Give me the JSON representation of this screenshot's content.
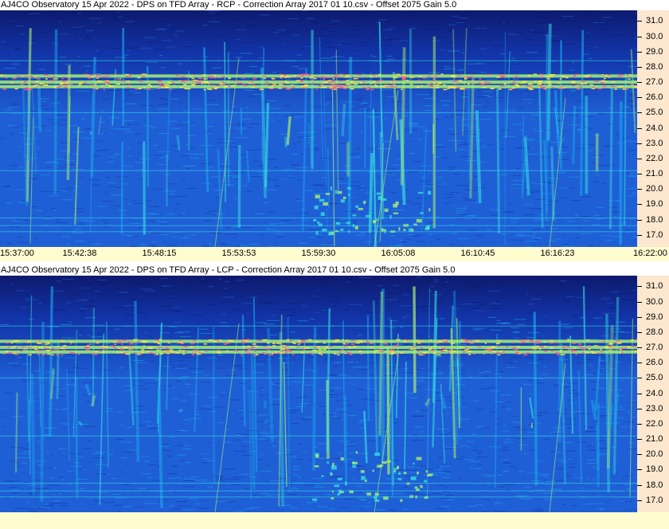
{
  "panels": [
    {
      "title": "AJ4CO Observatory 15 Apr 2022  -  DPS on TFD Array  -  RCP  -  Correction Array 2017 01 10.csv  -  Offset 2075  Gain 5.0"
    },
    {
      "title": "AJ4CO Observatory 15 Apr 2022  -  DPS on TFD Array  -  LCP  -  Correction Array 2017 01 10.csv  -  Offset 2075  Gain 5.0"
    }
  ],
  "chart_data": [
    {
      "type": "heatmap",
      "title": "AJ4CO Observatory 15 Apr 2022  -  DPS on TFD Array  -  RCP  -  Correction Array 2017 01 10.csv  -  Offset 2075  Gain 5.0",
      "xlabel": "",
      "ylabel": "",
      "x_ticks": [
        "15:37:00",
        "15:42:38",
        "15:48:15",
        "15:53:53",
        "15:59:30",
        "16:05:08",
        "16:10:45",
        "16:16:23",
        "16:22:00"
      ],
      "y_ticks": [
        "31.0",
        "30.0",
        "29.0",
        "28.0",
        "27.0",
        "26.0",
        "25.0",
        "24.0",
        "23.0",
        "22.0",
        "21.0",
        "20.0",
        "19.0",
        "18.0",
        "17.0"
      ],
      "ylim": [
        16.2,
        31.7
      ],
      "colormap": [
        "#0d1a6e",
        "#1234a8",
        "#1f5fd6",
        "#1aa2e8",
        "#35e0e0",
        "#a8f070",
        "#ffe640",
        "#ff5a8a"
      ],
      "interference_lines_mhz": [
        27.0,
        27.4,
        26.7,
        28.4,
        25.0,
        21.2,
        18.1,
        17.6,
        17.2
      ]
    },
    {
      "type": "heatmap",
      "title": "AJ4CO Observatory 15 Apr 2022  -  DPS on TFD Array  -  LCP  -  Correction Array 2017 01 10.csv  -  Offset 2075  Gain 5.0",
      "xlabel": "",
      "ylabel": "",
      "x_ticks": [],
      "y_ticks": [
        "31.0",
        "30.0",
        "29.0",
        "28.0",
        "27.0",
        "26.0",
        "25.0",
        "24.0",
        "23.0",
        "22.0",
        "21.0",
        "20.0",
        "19.0",
        "18.0",
        "17.0"
      ],
      "ylim": [
        16.2,
        31.7
      ],
      "colormap": [
        "#0d1a6e",
        "#1234a8",
        "#1f5fd6",
        "#1aa2e8",
        "#35e0e0",
        "#a8f070",
        "#ffe640",
        "#ff5a8a"
      ],
      "interference_lines_mhz": [
        27.0,
        27.4,
        26.7,
        28.4,
        25.0,
        21.2,
        18.1,
        17.6,
        17.2
      ]
    }
  ]
}
